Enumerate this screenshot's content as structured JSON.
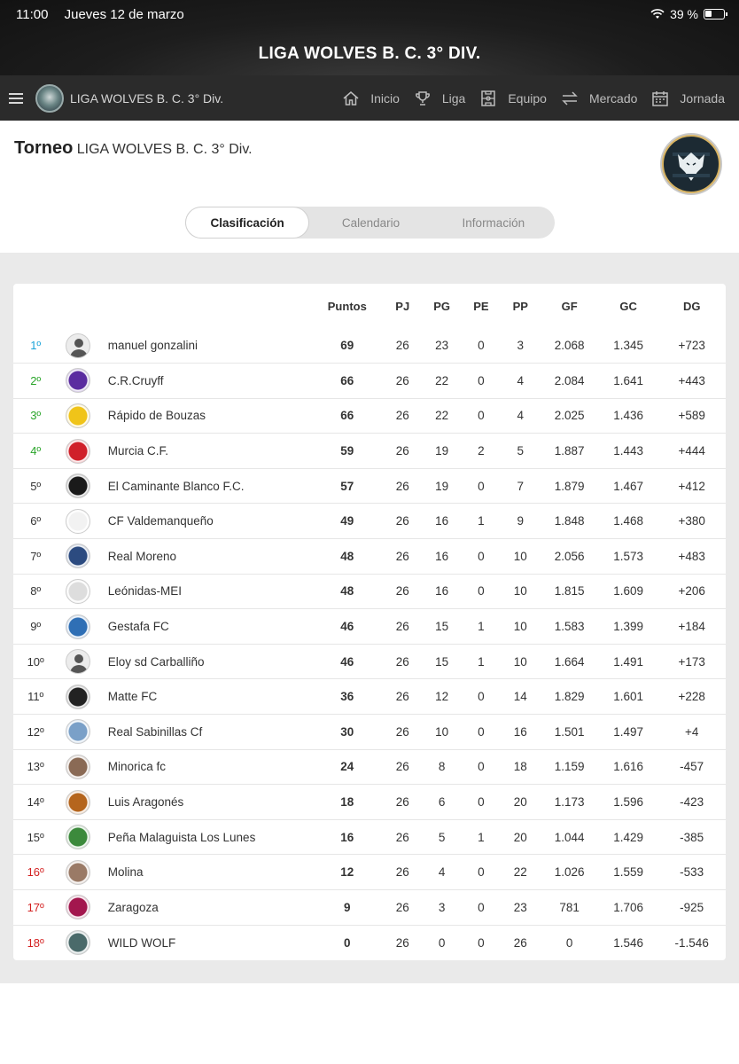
{
  "status_bar": {
    "time": "11:00",
    "date": "Jueves 12 de marzo",
    "battery": "39 %"
  },
  "app_title": "LIGA WOLVES B. C. 3° DIV.",
  "navbar": {
    "league_name": "LIGA WOLVES B. C. 3° Div.",
    "items": [
      {
        "label": "Inicio",
        "icon": "home-icon"
      },
      {
        "label": "Liga",
        "icon": "trophy-icon"
      },
      {
        "label": "Equipo",
        "icon": "pitch-icon"
      },
      {
        "label": "Mercado",
        "icon": "transfer-icon"
      },
      {
        "label": "Jornada",
        "icon": "calendar-icon"
      }
    ]
  },
  "torneo": {
    "prefix": "Torneo",
    "name": "LIGA WOLVES B. C. 3° Div."
  },
  "tabs": [
    "Clasificación",
    "Calendario",
    "Información"
  ],
  "table": {
    "headers": [
      "Puntos",
      "PJ",
      "PG",
      "PE",
      "PP",
      "GF",
      "GC",
      "DG"
    ],
    "rows": [
      {
        "pos": "1º",
        "team": "manuel gonzalini",
        "pts": "69",
        "pj": "26",
        "pg": "23",
        "pe": "0",
        "pp": "3",
        "gf": "2.068",
        "gc": "1.345",
        "dg": "+723",
        "pos_color": "#1aa3d9",
        "avatar": "generic"
      },
      {
        "pos": "2º",
        "team": "C.R.Cruyff",
        "pts": "66",
        "pj": "26",
        "pg": "22",
        "pe": "0",
        "pp": "4",
        "gf": "2.084",
        "gc": "1.641",
        "dg": "+443",
        "pos_color": "#2aa52a",
        "avatar": "#5b2ca0"
      },
      {
        "pos": "3º",
        "team": "Rápido de Bouzas",
        "pts": "66",
        "pj": "26",
        "pg": "22",
        "pe": "0",
        "pp": "4",
        "gf": "2.025",
        "gc": "1.436",
        "dg": "+589",
        "pos_color": "#2aa52a",
        "avatar": "#f0c419"
      },
      {
        "pos": "4º",
        "team": "Murcia C.F.",
        "pts": "59",
        "pj": "26",
        "pg": "19",
        "pe": "2",
        "pp": "5",
        "gf": "1.887",
        "gc": "1.443",
        "dg": "+444",
        "pos_color": "#2aa52a",
        "avatar": "#d0202a"
      },
      {
        "pos": "5º",
        "team": "El Caminante Blanco F.C.",
        "pts": "57",
        "pj": "26",
        "pg": "19",
        "pe": "0",
        "pp": "7",
        "gf": "1.879",
        "gc": "1.467",
        "dg": "+412",
        "pos_color": "#333333",
        "avatar": "#1a1a1a"
      },
      {
        "pos": "6º",
        "team": "CF Valdemanqueño",
        "pts": "49",
        "pj": "26",
        "pg": "16",
        "pe": "1",
        "pp": "9",
        "gf": "1.848",
        "gc": "1.468",
        "dg": "+380",
        "pos_color": "#333333",
        "avatar": "#f2f2f2"
      },
      {
        "pos": "7º",
        "team": "Real Moreno",
        "pts": "48",
        "pj": "26",
        "pg": "16",
        "pe": "0",
        "pp": "10",
        "gf": "2.056",
        "gc": "1.573",
        "dg": "+483",
        "pos_color": "#333333",
        "avatar": "#2c4b80"
      },
      {
        "pos": "8º",
        "team": "Leónidas-MEI",
        "pts": "48",
        "pj": "26",
        "pg": "16",
        "pe": "0",
        "pp": "10",
        "gf": "1.815",
        "gc": "1.609",
        "dg": "+206",
        "pos_color": "#333333",
        "avatar": "#dddddd"
      },
      {
        "pos": "9º",
        "team": "Gestafa FC",
        "pts": "46",
        "pj": "26",
        "pg": "15",
        "pe": "1",
        "pp": "10",
        "gf": "1.583",
        "gc": "1.399",
        "dg": "+184",
        "pos_color": "#333333",
        "avatar": "#2f6fb5"
      },
      {
        "pos": "10º",
        "team": "Eloy sd Carballiño",
        "pts": "46",
        "pj": "26",
        "pg": "15",
        "pe": "1",
        "pp": "10",
        "gf": "1.664",
        "gc": "1.491",
        "dg": "+173",
        "pos_color": "#333333",
        "avatar": "generic"
      },
      {
        "pos": "11º",
        "team": "Matte FC",
        "pts": "36",
        "pj": "26",
        "pg": "12",
        "pe": "0",
        "pp": "14",
        "gf": "1.829",
        "gc": "1.601",
        "dg": "+228",
        "pos_color": "#333333",
        "avatar": "#222222"
      },
      {
        "pos": "12º",
        "team": "Real Sabinillas Cf",
        "pts": "30",
        "pj": "26",
        "pg": "10",
        "pe": "0",
        "pp": "16",
        "gf": "1.501",
        "gc": "1.497",
        "dg": "+4",
        "pos_color": "#333333",
        "avatar": "#7aa0c8"
      },
      {
        "pos": "13º",
        "team": "Minorica fc",
        "pts": "24",
        "pj": "26",
        "pg": "8",
        "pe": "0",
        "pp": "18",
        "gf": "1.159",
        "gc": "1.616",
        "dg": "-457",
        "pos_color": "#333333",
        "avatar": "#8a6a55"
      },
      {
        "pos": "14º",
        "team": "Luis Aragonés",
        "pts": "18",
        "pj": "26",
        "pg": "6",
        "pe": "0",
        "pp": "20",
        "gf": "1.173",
        "gc": "1.596",
        "dg": "-423",
        "pos_color": "#333333",
        "avatar": "#b5651d"
      },
      {
        "pos": "15º",
        "team": "Peña Malaguista Los Lunes",
        "pts": "16",
        "pj": "26",
        "pg": "5",
        "pe": "1",
        "pp": "20",
        "gf": "1.044",
        "gc": "1.429",
        "dg": "-385",
        "pos_color": "#333333",
        "avatar": "#3c8a3c"
      },
      {
        "pos": "16º",
        "team": "Molina",
        "pts": "12",
        "pj": "26",
        "pg": "4",
        "pe": "0",
        "pp": "22",
        "gf": "1.026",
        "gc": "1.559",
        "dg": "-533",
        "pos_color": "#d32020",
        "avatar": "#9a7a66"
      },
      {
        "pos": "17º",
        "team": "Zaragoza",
        "pts": "9",
        "pj": "26",
        "pg": "3",
        "pe": "0",
        "pp": "23",
        "gf": "781",
        "gc": "1.706",
        "dg": "-925",
        "pos_color": "#d32020",
        "avatar": "#a3174e"
      },
      {
        "pos": "18º",
        "team": "WILD WOLF",
        "pts": "0",
        "pj": "26",
        "pg": "0",
        "pe": "0",
        "pp": "26",
        "gf": "0",
        "gc": "1.546",
        "dg": "-1.546",
        "pos_color": "#d32020",
        "avatar": "#4a6a6a"
      }
    ]
  }
}
